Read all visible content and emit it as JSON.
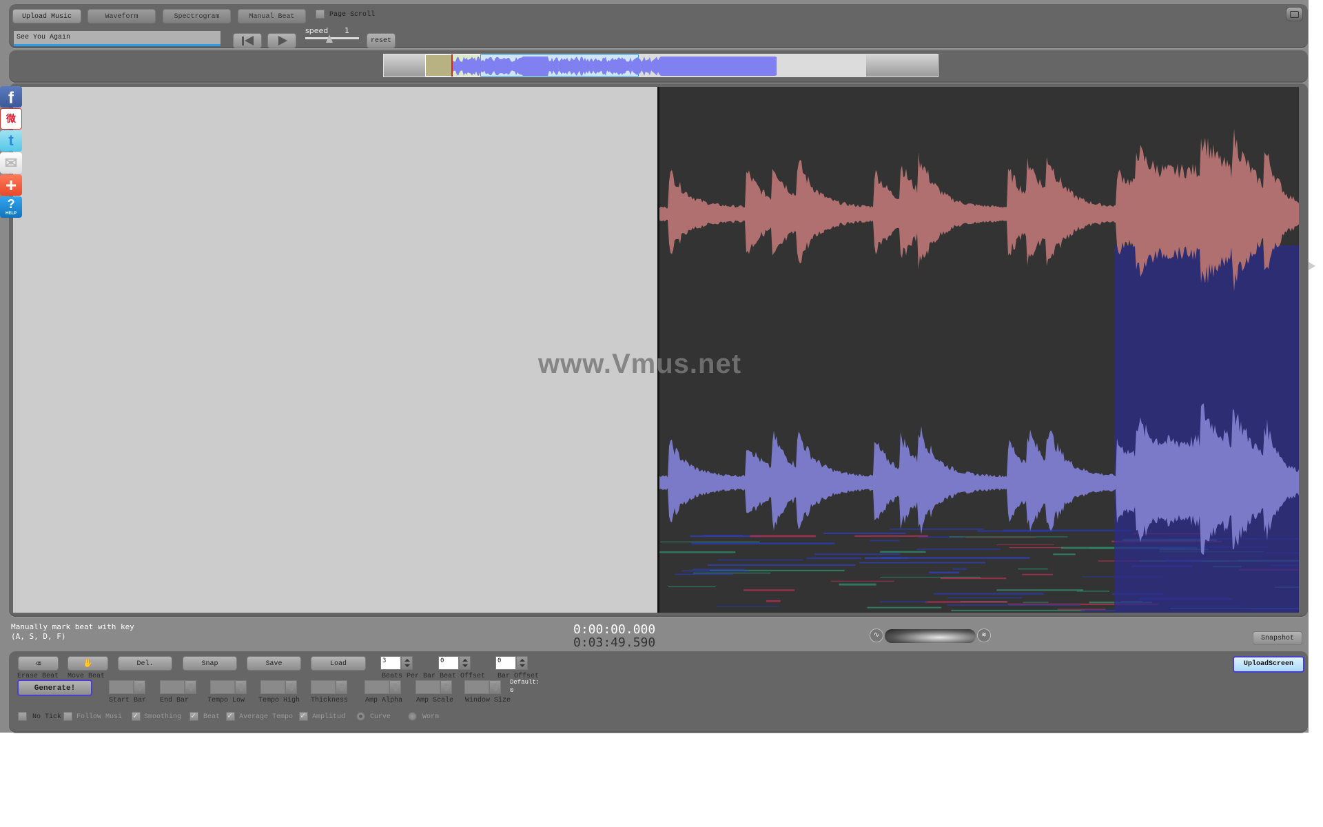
{
  "toolbar": {
    "upload_music": "Upload Music",
    "waveform": "Waveform",
    "spectrogram": "Spectrogram",
    "manual_beat": "Manual Beat",
    "page_scroll_label": "Page Scroll",
    "page_scroll_checked": false,
    "song_title": "See You Again",
    "speed_label": "speed",
    "speed_value": "1",
    "reset": "reset",
    "icons": {
      "rewind": "skip-to-start-icon",
      "play": "play-icon",
      "fullscreen": "fullscreen-icon"
    }
  },
  "overview": {
    "playhead_fraction": 0.12,
    "visible_window_fraction": [
      0.13,
      0.41
    ]
  },
  "sidebar_social": [
    {
      "name": "facebook",
      "glyph": "f",
      "color": "#3b5998"
    },
    {
      "name": "weibo",
      "glyph": "微",
      "color": "#e6162d"
    },
    {
      "name": "twitter",
      "glyph": "t",
      "color": "#55c6e8"
    },
    {
      "name": "email",
      "glyph": "✉",
      "color": "#e8e8e8"
    },
    {
      "name": "share-plus",
      "glyph": "+",
      "color": "#f0593a"
    },
    {
      "name": "help",
      "glyph": "?",
      "color": "#1a8fd8",
      "sub": "HELP"
    }
  ],
  "canvas": {
    "watermark": "www.Vmus.net",
    "left_bg": "#cccccc",
    "right_bg": "#333333",
    "waveform_top_color": "#b07070",
    "waveform_bottom_color": "#7a7ac8"
  },
  "status": {
    "hint_line1": "Manually mark beat with key",
    "hint_line2": "(A, S, D, F)",
    "current_time": "0:00:00.000",
    "total_time": "0:03:49.590",
    "snapshot": "Snapshot",
    "upload_screen": "UploadScreen"
  },
  "controls": {
    "erase_beat": "Erase Beat",
    "move_beat": "Move Beat",
    "del": "Del.",
    "snap": "Snap",
    "save": "Save",
    "load": "Load",
    "beats_per_bar_label": "Beats Per Bar",
    "beats_per_bar_value": "3",
    "beat_offset_label": "Beat Offset",
    "beat_offset_value": "0",
    "bar_offset_label": "Bar Offset",
    "bar_offset_value": "0",
    "generate": "Generate!",
    "start_bar": "Start Bar",
    "end_bar": "End Bar",
    "tempo_low": "Tempo Low",
    "tempo_high": "Tempo High",
    "thickness": "Thickness",
    "amp_alpha": "Amp Alpha",
    "amp_scale": "Amp Scale",
    "window_size": "Window Size",
    "default_label": "Default:",
    "default_value": "0",
    "no_tick": "No Tick",
    "follow_music": "Follow Musi",
    "smoothing": "Smoothing",
    "beat": "Beat",
    "average_tempo": "Average Tempo",
    "amplitude": "Amplitud",
    "curve": "Curve",
    "worm": "Worm"
  }
}
